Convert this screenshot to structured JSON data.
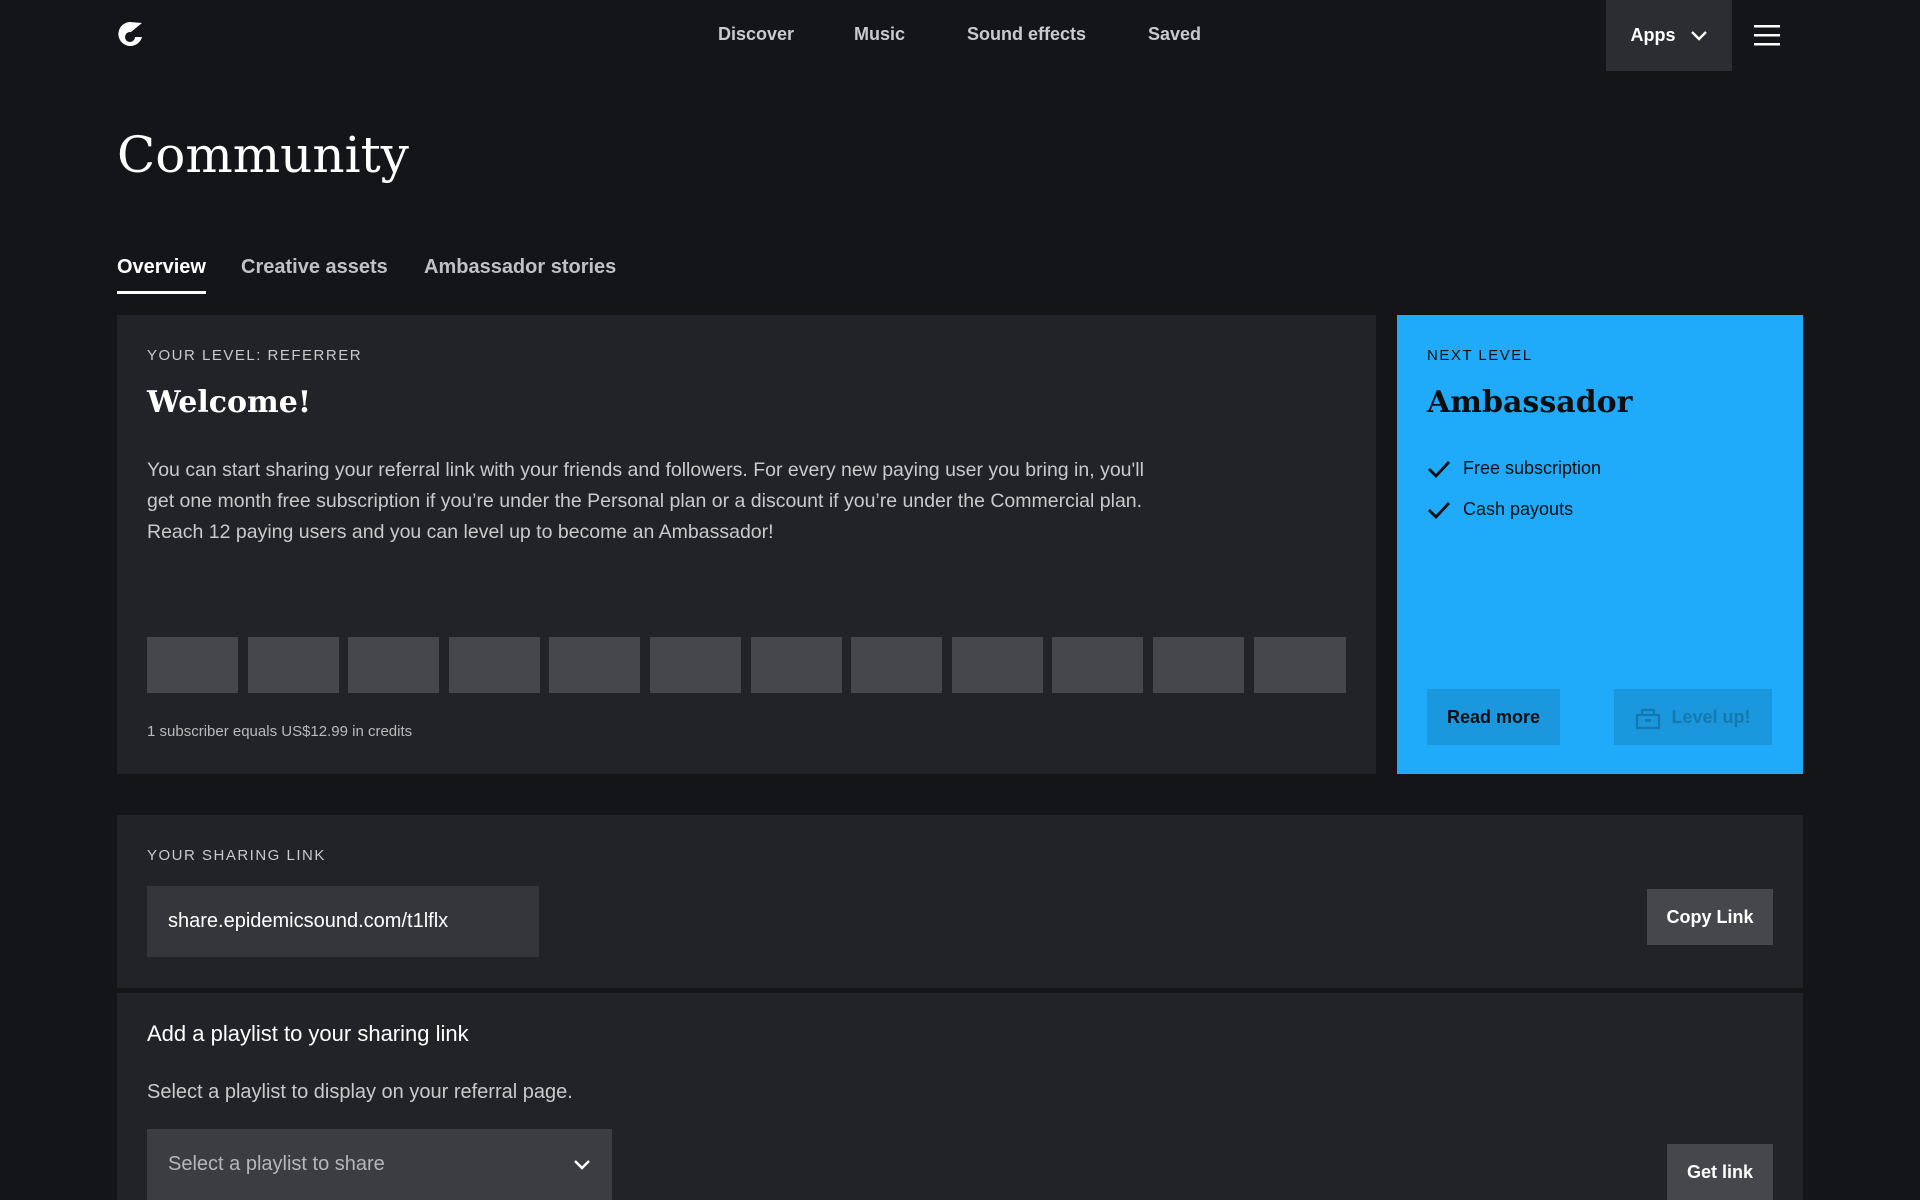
{
  "nav": {
    "items": [
      "Discover",
      "Music",
      "Sound effects",
      "Saved"
    ],
    "apps_label": "Apps"
  },
  "page": {
    "title": "Community"
  },
  "tabs": [
    "Overview",
    "Creative assets",
    "Ambassador stories"
  ],
  "level_card": {
    "eyebrow": "YOUR LEVEL: REFERRER",
    "heading": "Welcome!",
    "body": "You can start sharing your referral link with your friends and followers. For every new paying user you bring in, you'll get one month free subscription if you’re under the Personal plan or a discount if you’re under the Commercial plan. Reach 12 paying users and you can level up to become an Ambassador!",
    "progress_total": 12,
    "progress_filled": 0,
    "footnote": "1 subscriber equals US$12.99 in credits"
  },
  "next_level": {
    "eyebrow": "NEXT LEVEL",
    "heading": "Ambassador",
    "perks": [
      "Free subscription",
      "Cash payouts"
    ],
    "read_more_label": "Read more",
    "level_up_label": "Level up!"
  },
  "sharing": {
    "eyebrow": "YOUR SHARING LINK",
    "link": "share.epidemicsound.com/t1lflx",
    "copy_label": "Copy Link"
  },
  "playlist": {
    "title": "Add a playlist to your sharing link",
    "description": "Select a playlist to display on your referral page.",
    "select_placeholder": "Select a playlist to share",
    "get_link_label": "Get link"
  },
  "colors": {
    "background": "#141519",
    "card": "#222328",
    "accent": "#1fabf9",
    "button": "#45474d"
  }
}
